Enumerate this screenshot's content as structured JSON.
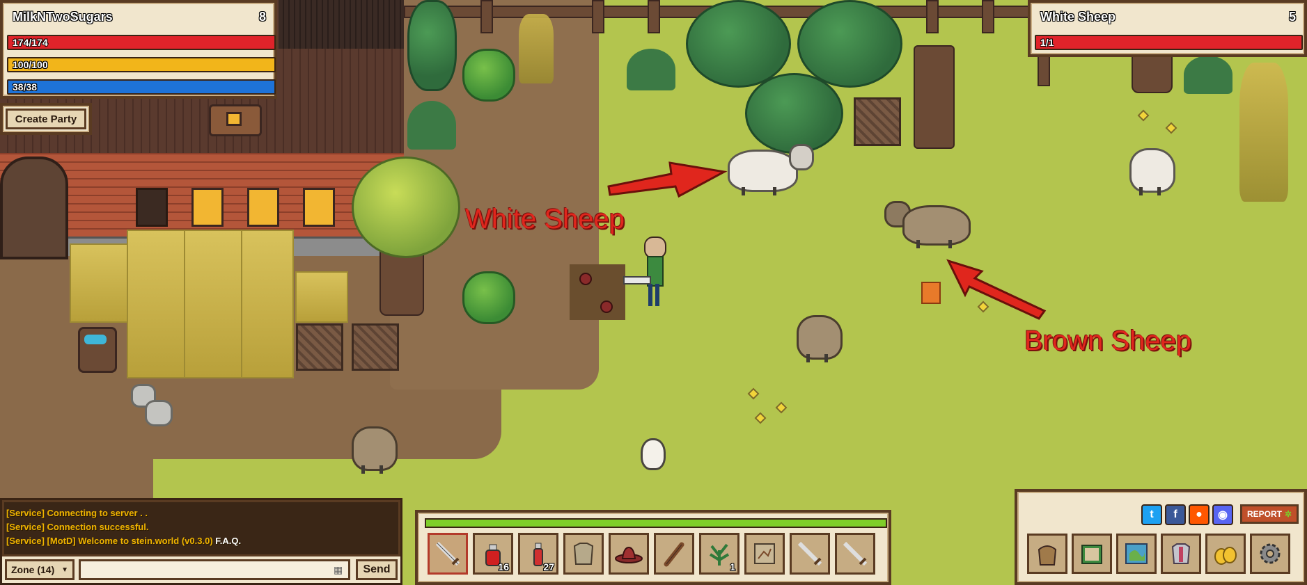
{
  "player": {
    "name": "MilkNTwoSugars",
    "level": "8",
    "health": "174/174",
    "stamina": "100/100",
    "mana": "38/38",
    "health_fill": 1.0,
    "stamina_fill": 1.0,
    "mana_fill": 1.0,
    "colors": {
      "health": "#e0232a",
      "stamina": "#f2b51a",
      "mana": "#1e73d8"
    }
  },
  "party": {
    "create_label": "Create Party"
  },
  "target": {
    "name": "White Sheep",
    "level": "5",
    "health": "1/1",
    "health_fill": 1.0
  },
  "annotations": {
    "white_sheep_label": "White Sheep",
    "brown_sheep_label": "Brown Sheep",
    "color": "#e0261d"
  },
  "chat": {
    "lines": [
      "[Service] Connecting to server . .",
      "[Service] Connection successful.",
      "[Service] [MotD] Welcome to stein.world (v0.3.0)"
    ],
    "faq_link": "F.A.Q.",
    "channel": "Zone (14)",
    "input_value": "",
    "send_label": "Send"
  },
  "hotbar": {
    "progress_fill": 1.0,
    "slots": [
      {
        "icon": "sword-icon",
        "count": ""
      },
      {
        "icon": "health-potion-icon",
        "count": "16"
      },
      {
        "icon": "vial-potion-icon",
        "count": "27"
      },
      {
        "icon": "chest-armor-icon",
        "count": ""
      },
      {
        "icon": "hat-icon",
        "count": ""
      },
      {
        "icon": "club-icon",
        "count": ""
      },
      {
        "icon": "herb-icon",
        "count": "1"
      },
      {
        "icon": "map-scroll-icon",
        "count": ""
      },
      {
        "icon": "sword-icon",
        "count": ""
      },
      {
        "icon": "sword-icon",
        "count": ""
      }
    ]
  },
  "menu": {
    "report_label": "REPORT",
    "social": [
      "twitter-icon",
      "facebook-icon",
      "reddit-icon",
      "discord-icon"
    ],
    "buttons": [
      "inventory-bag-icon",
      "journal-book-icon",
      "world-map-icon",
      "character-armor-icon",
      "gold-coins-icon",
      "settings-gear-icon"
    ]
  }
}
